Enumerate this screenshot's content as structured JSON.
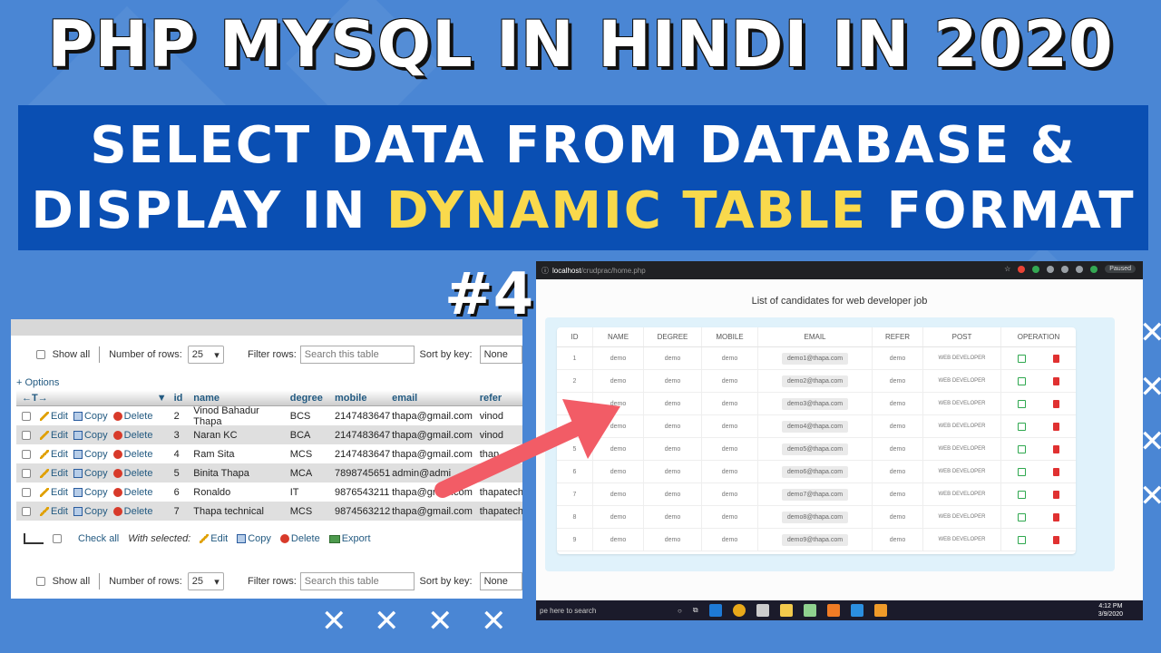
{
  "headline": {
    "title": "PHP MYSQL IN HINDI IN 2020",
    "line1": "SELECT DATA FROM DATABASE  &",
    "line2_pre": "DISPLAY IN ",
    "line2_highlight": "DYNAMIC TABLE",
    "line2_post": " FORMAT",
    "episode": "#4"
  },
  "colors": {
    "background": "#4a86d4",
    "banner": "#0a4fb3",
    "highlight": "#f9d94c",
    "arrow": "#f25c66"
  },
  "pma": {
    "show_all": "Show all",
    "number_of_rows": "Number of rows:",
    "rows_value": "25",
    "filter_rows": "Filter rows:",
    "search_placeholder": "Search this table",
    "sort_by_key": "Sort by key:",
    "sort_value": "None",
    "options": "+ Options",
    "columns": [
      "id",
      "name",
      "degree",
      "mobile",
      "email",
      "refer"
    ],
    "actions": {
      "edit": "Edit",
      "copy": "Copy",
      "delete": "Delete"
    },
    "rows": [
      {
        "id": "2",
        "name": "Vinod Bahadur Thapa",
        "degree": "BCS",
        "mobile": "2147483647",
        "email": "thapa@gmail.com",
        "refer": "vinod"
      },
      {
        "id": "3",
        "name": "Naran KC",
        "degree": "BCA",
        "mobile": "2147483647",
        "email": "thapa@gmail.com",
        "refer": "vinod"
      },
      {
        "id": "4",
        "name": "Ram Sita",
        "degree": "MCS",
        "mobile": "2147483647",
        "email": "thapa@gmail.com",
        "refer": "thap"
      },
      {
        "id": "5",
        "name": "Binita Thapa",
        "degree": "MCA",
        "mobile": "7898745651",
        "email": "admin@admi",
        "refer": ""
      },
      {
        "id": "6",
        "name": "Ronaldo",
        "degree": "IT",
        "mobile": "9876543211",
        "email": "thapa@gmail.com",
        "refer": "thapatech"
      },
      {
        "id": "7",
        "name": "Thapa technical",
        "degree": "MCS",
        "mobile": "9874563212",
        "email": "thapa@gmail.com",
        "refer": "thapatech"
      }
    ],
    "bulk": {
      "check_all": "Check all",
      "with_selected": "With selected:",
      "edit": "Edit",
      "copy": "Copy",
      "delete": "Delete",
      "export": "Export"
    }
  },
  "browser": {
    "url_host": "localhost",
    "url_path": "/crudprac/home.php",
    "paused": "Paused",
    "heading": "List of candidates for web developer job",
    "columns": [
      "ID",
      "NAME",
      "DEGREE",
      "MOBILE",
      "EMAIL",
      "REFER",
      "POST",
      "OPERATION"
    ],
    "rows": [
      {
        "id": "1",
        "name": "demo",
        "degree": "demo",
        "mobile": "demo",
        "email": "demo1@thapa.com",
        "refer": "demo",
        "post": "WEB DEVELOPER"
      },
      {
        "id": "2",
        "name": "demo",
        "degree": "demo",
        "mobile": "demo",
        "email": "demo2@thapa.com",
        "refer": "demo",
        "post": "WEB DEVELOPER"
      },
      {
        "id": "",
        "name": "demo",
        "degree": "demo",
        "mobile": "demo",
        "email": "demo3@thapa.com",
        "refer": "demo",
        "post": "WEB DEVELOPER"
      },
      {
        "id": "",
        "name": "demo",
        "degree": "demo",
        "mobile": "demo",
        "email": "demo4@thapa.com",
        "refer": "demo",
        "post": "WEB DEVELOPER"
      },
      {
        "id": "5",
        "name": "demo",
        "degree": "demo",
        "mobile": "demo",
        "email": "demo5@thapa.com",
        "refer": "demo",
        "post": "WEB DEVELOPER"
      },
      {
        "id": "6",
        "name": "demo",
        "degree": "demo",
        "mobile": "demo",
        "email": "demo6@thapa.com",
        "refer": "demo",
        "post": "WEB DEVELOPER"
      },
      {
        "id": "7",
        "name": "demo",
        "degree": "demo",
        "mobile": "demo",
        "email": "demo7@thapa.com",
        "refer": "demo",
        "post": "WEB DEVELOPER"
      },
      {
        "id": "8",
        "name": "demo",
        "degree": "demo",
        "mobile": "demo",
        "email": "demo8@thapa.com",
        "refer": "demo",
        "post": "WEB DEVELOPER"
      },
      {
        "id": "9",
        "name": "demo",
        "degree": "demo",
        "mobile": "demo",
        "email": "demo9@thapa.com",
        "refer": "demo",
        "post": "WEB DEVELOPER"
      }
    ],
    "taskbar": {
      "search": "pe here to search",
      "time": "4:12 PM",
      "date": "3/9/2020"
    }
  }
}
